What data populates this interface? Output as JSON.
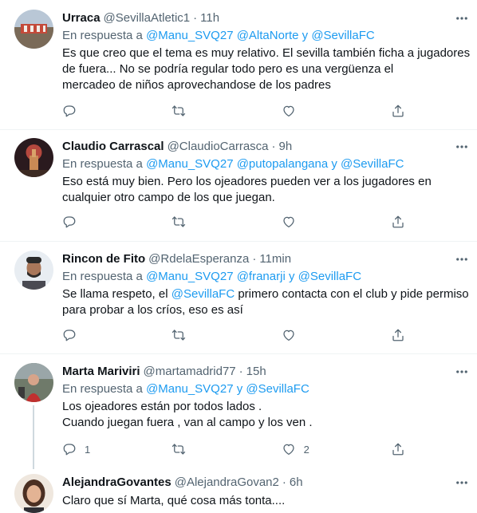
{
  "reply_prefix": "En respuesta a",
  "conjunction": "y",
  "tweets": [
    {
      "name": "Urraca",
      "handle": "@SevillaAtletic1",
      "time": "11h",
      "mentions": [
        "@Manu_SVQ27",
        "@AltaNorte",
        "@SevillaFC"
      ],
      "text_lines": [
        "Es que creo que el tema es muy relativo. El sevilla también ficha a jugadores",
        "de fuera... No se podría regular todo pero es una vergüenza el",
        "mercadeo de niños aprovechandose de los padres"
      ],
      "replies": "",
      "retweets": "",
      "likes": ""
    },
    {
      "name": "Claudio Carrascal",
      "handle": "@ClaudioCarrasca",
      "time": "9h",
      "mentions": [
        "@Manu_SVQ27",
        "@putopalangana",
        "@SevillaFC"
      ],
      "text_lines": [
        "Eso está muy bien. Pero los ojeadores pueden ver a los jugadores en",
        "cualquier otro campo de los que juegan."
      ],
      "replies": "",
      "retweets": "",
      "likes": ""
    },
    {
      "name": "Rincon de Fito",
      "handle": "@RdelaEsperanza",
      "time": "11min",
      "mentions": [
        "@Manu_SVQ27",
        "@franarji",
        "@SevillaFC"
      ],
      "text_line1_before": "Se llama respeto, el ",
      "text_line1_mention": "@SevillaFC",
      "text_line1_after": " primero contacta con el club y pide permiso",
      "text_line2": "para probar a los críos, eso es así",
      "replies": "",
      "retweets": "",
      "likes": ""
    },
    {
      "name": "Marta Mariviri",
      "handle": "@martamadrid77",
      "time": "15h",
      "mentions": [
        "@Manu_SVQ27",
        "@SevillaFC"
      ],
      "text_lines": [
        "Los ojeadores están por todos lados .",
        "Cuando juegan fuera , van al campo y los ven ."
      ],
      "replies": "1",
      "retweets": "",
      "likes": "2"
    },
    {
      "name": "AlejandraGovantes",
      "handle": "@AlejandraGovan2",
      "time": "6h",
      "text_lines": [
        "Claro que sí Marta, qué cosa más tonta...."
      ]
    }
  ],
  "icons": {
    "more": "more-horizontal-icon",
    "reply": "reply-icon",
    "retweet": "retweet-icon",
    "like": "heart-icon",
    "share": "share-icon"
  },
  "colors": {
    "link": "#1d9bf0",
    "secondary": "#536471",
    "text": "#0f1419",
    "divider": "#eff3f4"
  }
}
